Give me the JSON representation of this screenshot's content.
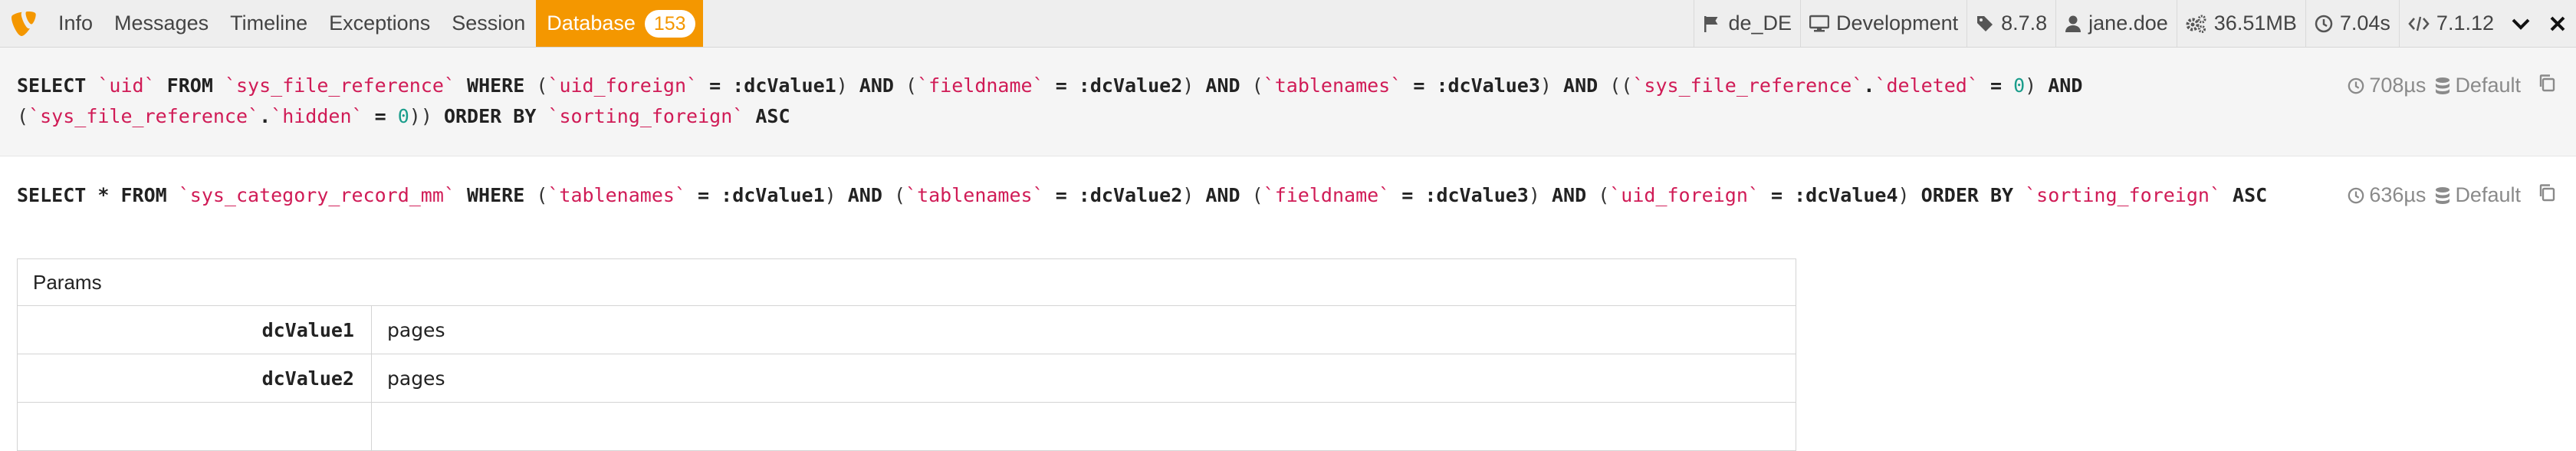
{
  "toolbar": {
    "tabs": [
      {
        "label": "Info"
      },
      {
        "label": "Messages"
      },
      {
        "label": "Timeline"
      },
      {
        "label": "Exceptions"
      },
      {
        "label": "Session"
      },
      {
        "label": "Database",
        "badge": "153"
      }
    ],
    "active_tab": "Database",
    "info": {
      "locale": "de_DE",
      "context": "Development",
      "version": "8.7.8",
      "user": "jane.doe",
      "memory": "36.51MB",
      "time": "7.04s",
      "php": "7.1.12"
    }
  },
  "queries": [
    {
      "sql_tokens": [
        {
          "t": "k",
          "s": "SELECT "
        },
        {
          "t": "n",
          "s": "`uid`"
        },
        {
          "t": "k",
          "s": " FROM "
        },
        {
          "t": "n",
          "s": "`sys_file_reference`"
        },
        {
          "t": "k",
          "s": " WHERE "
        },
        {
          "t": "p",
          "s": "("
        },
        {
          "t": "n",
          "s": "`uid_foreign`"
        },
        {
          "t": "k",
          "s": " = :dcValue1"
        },
        {
          "t": "p",
          "s": ")"
        },
        {
          "t": "k",
          "s": " AND "
        },
        {
          "t": "p",
          "s": "("
        },
        {
          "t": "n",
          "s": "`fieldname`"
        },
        {
          "t": "k",
          "s": " = :dcValue2"
        },
        {
          "t": "p",
          "s": ")"
        },
        {
          "t": "k",
          "s": " AND "
        },
        {
          "t": "p",
          "s": "("
        },
        {
          "t": "n",
          "s": "`tablenames`"
        },
        {
          "t": "k",
          "s": " = :dcValue3"
        },
        {
          "t": "p",
          "s": ")"
        },
        {
          "t": "k",
          "s": " AND "
        },
        {
          "t": "p",
          "s": "(("
        },
        {
          "t": "n",
          "s": "`sys_file_reference`"
        },
        {
          "t": "k",
          "s": "."
        },
        {
          "t": "n",
          "s": "`deleted`"
        },
        {
          "t": "k",
          "s": " = "
        },
        {
          "t": "v",
          "s": "0"
        },
        {
          "t": "p",
          "s": ")"
        },
        {
          "t": "k",
          "s": " AND "
        },
        {
          "t": "p",
          "s": "("
        },
        {
          "t": "n",
          "s": "`sys_file_reference`"
        },
        {
          "t": "k",
          "s": "."
        },
        {
          "t": "n",
          "s": "`hidden`"
        },
        {
          "t": "k",
          "s": " = "
        },
        {
          "t": "v",
          "s": "0"
        },
        {
          "t": "p",
          "s": "))"
        },
        {
          "t": "k",
          "s": " ORDER BY "
        },
        {
          "t": "n",
          "s": "`sorting_foreign`"
        },
        {
          "t": "k",
          "s": " ASC"
        }
      ],
      "duration": "708µs",
      "connection": "Default"
    },
    {
      "sql_tokens": [
        {
          "t": "k",
          "s": "SELECT * FROM "
        },
        {
          "t": "n",
          "s": "`sys_category_record_mm`"
        },
        {
          "t": "k",
          "s": " WHERE "
        },
        {
          "t": "p",
          "s": "("
        },
        {
          "t": "n",
          "s": "`tablenames`"
        },
        {
          "t": "k",
          "s": " = :dcValue1"
        },
        {
          "t": "p",
          "s": ")"
        },
        {
          "t": "k",
          "s": " AND "
        },
        {
          "t": "p",
          "s": "("
        },
        {
          "t": "n",
          "s": "`tablenames`"
        },
        {
          "t": "k",
          "s": " = :dcValue2"
        },
        {
          "t": "p",
          "s": ")"
        },
        {
          "t": "k",
          "s": " AND "
        },
        {
          "t": "p",
          "s": "("
        },
        {
          "t": "n",
          "s": "`fieldname`"
        },
        {
          "t": "k",
          "s": " = :dcValue3"
        },
        {
          "t": "p",
          "s": ")"
        },
        {
          "t": "k",
          "s": " AND "
        },
        {
          "t": "p",
          "s": "("
        },
        {
          "t": "n",
          "s": "`uid_foreign`"
        },
        {
          "t": "k",
          "s": " = :dcValue4"
        },
        {
          "t": "p",
          "s": ")"
        },
        {
          "t": "k",
          "s": " ORDER BY "
        },
        {
          "t": "n",
          "s": "`sorting_foreign`"
        },
        {
          "t": "k",
          "s": " ASC"
        }
      ],
      "duration": "636µs",
      "connection": "Default",
      "params_header": "Params",
      "params": [
        {
          "key": "dcValue1",
          "value": "pages"
        },
        {
          "key": "dcValue2",
          "value": "pages"
        }
      ]
    }
  ],
  "colors": {
    "accent": "#f49700",
    "identifier": "#d01b56",
    "number": "#1a9d8b",
    "toolbar_bg": "#eeeeee"
  },
  "icons": {
    "logo": "typo3-logo-icon",
    "locale": "flag-icon",
    "context": "desktop-icon",
    "version": "tag-icon",
    "user": "user-icon",
    "memory": "gears-icon",
    "time": "clock-icon",
    "php": "code-icon",
    "duration": "clock-icon",
    "connection": "database-icon",
    "copy": "copy-icon",
    "collapse": "chevron-down-icon",
    "close": "close-icon"
  }
}
